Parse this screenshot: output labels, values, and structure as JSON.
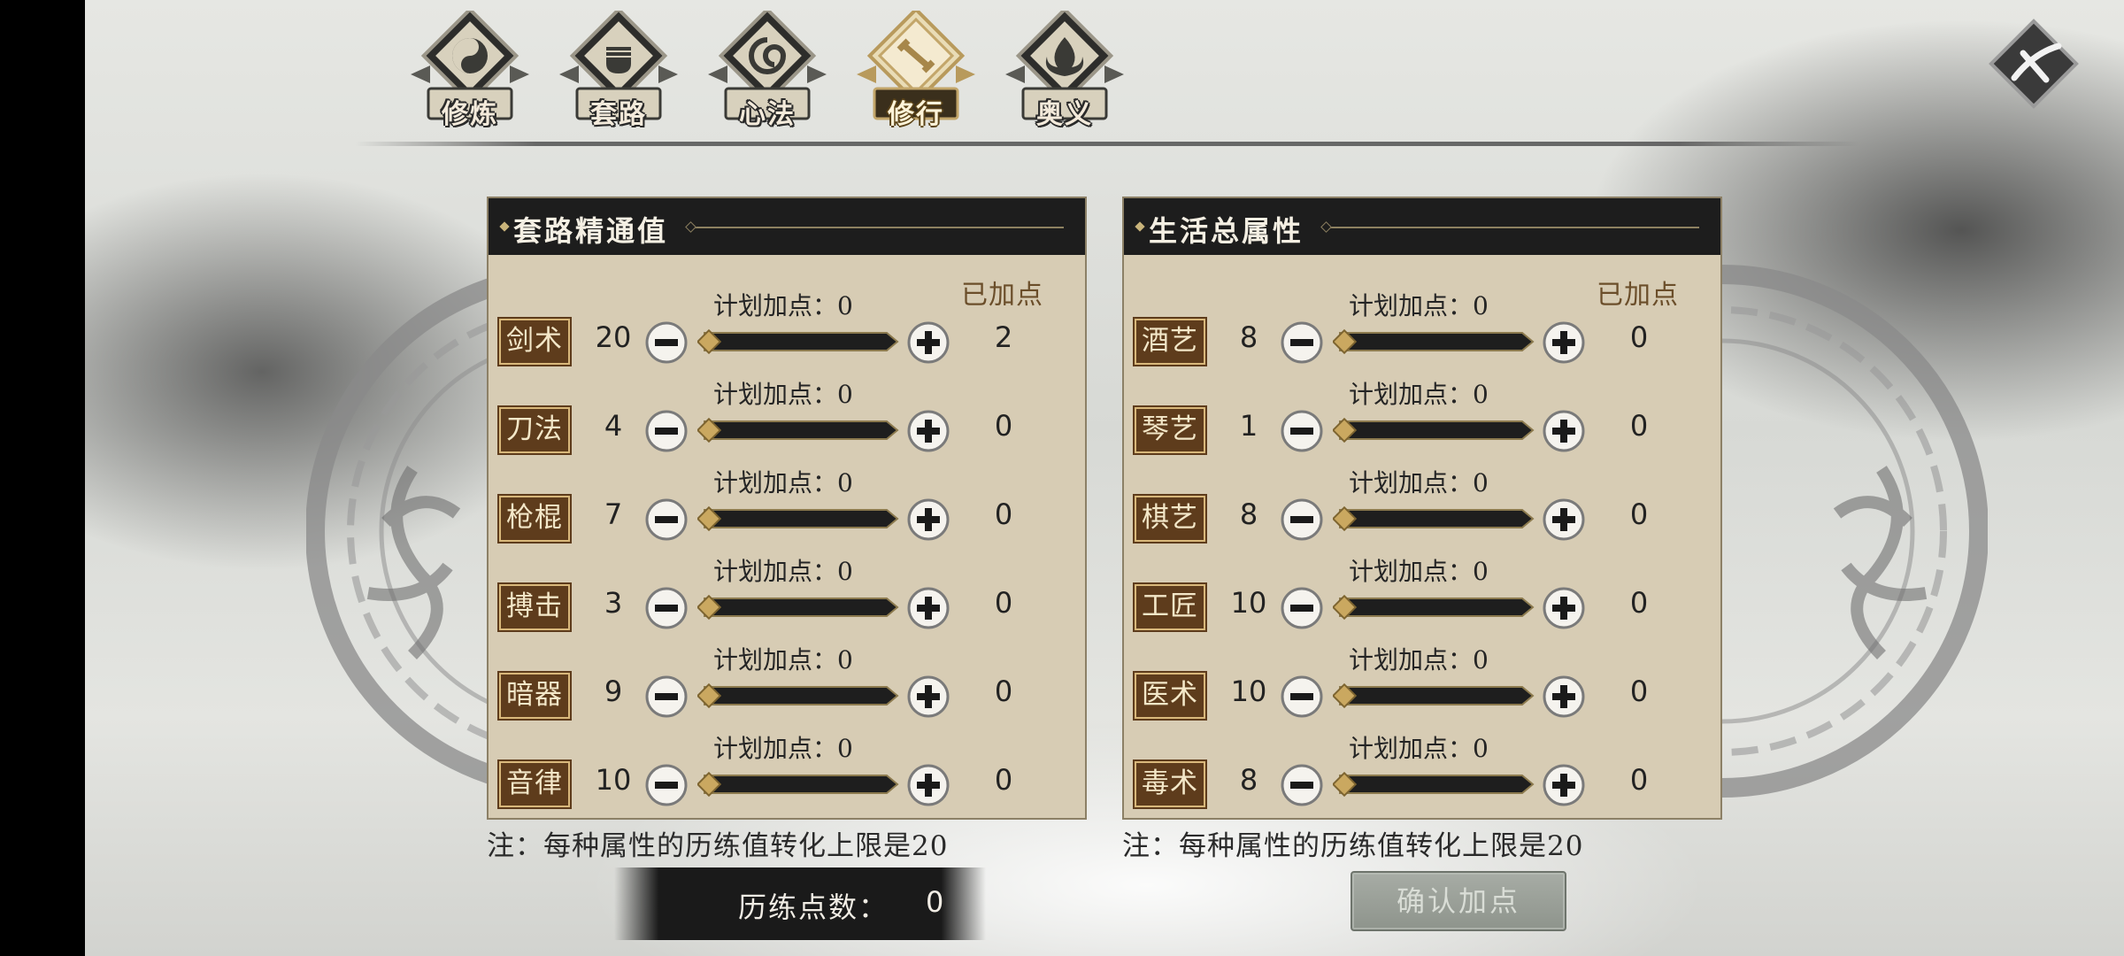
{
  "tabs": [
    {
      "label": "修炼",
      "icon": "taiji-emblem-icon",
      "active": false
    },
    {
      "label": "套路",
      "icon": "fist-emblem-icon",
      "active": false
    },
    {
      "label": "心法",
      "icon": "swirl-emblem-icon",
      "active": false
    },
    {
      "label": "修行",
      "icon": "scroll-emblem-icon",
      "active": true
    },
    {
      "label": "奥义",
      "icon": "flame-emblem-icon",
      "active": false
    }
  ],
  "close_icon": "close-icon",
  "left_panel": {
    "title": "套路精通值",
    "added_header": "已加点",
    "rows": [
      {
        "name": "剑术",
        "value": "20",
        "plan": "计划加点：0",
        "added": "2",
        "slider_level": 0
      },
      {
        "name": "刀法",
        "value": "4",
        "plan": "计划加点：0",
        "added": "0",
        "slider_level": 0
      },
      {
        "name": "枪棍",
        "value": "7",
        "plan": "计划加点：0",
        "added": "0",
        "slider_level": 0
      },
      {
        "name": "搏击",
        "value": "3",
        "plan": "计划加点：0",
        "added": "0",
        "slider_level": 0
      },
      {
        "name": "暗器",
        "value": "9",
        "plan": "计划加点：0",
        "added": "0",
        "slider_level": 0
      },
      {
        "name": "音律",
        "value": "10",
        "plan": "计划加点：0",
        "added": "0",
        "slider_level": 0
      }
    ],
    "note": "注：每种属性的历练值转化上限是20"
  },
  "right_panel": {
    "title": "生活总属性",
    "added_header": "已加点",
    "rows": [
      {
        "name": "酒艺",
        "value": "8",
        "plan": "计划加点：0",
        "added": "0",
        "slider_level": 0
      },
      {
        "name": "琴艺",
        "value": "1",
        "plan": "计划加点：0",
        "added": "0",
        "slider_level": 0
      },
      {
        "name": "棋艺",
        "value": "8",
        "plan": "计划加点：0",
        "added": "0",
        "slider_level": 0
      },
      {
        "name": "工匠",
        "value": "10",
        "plan": "计划加点：0",
        "added": "0",
        "slider_level": 0
      },
      {
        "name": "医术",
        "value": "10",
        "plan": "计划加点：0",
        "added": "0",
        "slider_level": 0
      },
      {
        "name": "毒术",
        "value": "8",
        "plan": "计划加点：0",
        "added": "0",
        "slider_level": 0
      }
    ],
    "note": "注：每种属性的历练值转化上限是20"
  },
  "points": {
    "label": "历练点数：",
    "value": "0"
  },
  "confirm_label": "确认加点",
  "colors": {
    "panel_bg": "#d7ccb4",
    "header_bg": "#1d1d1d",
    "label_brown": "#5e3c1c",
    "gold": "#d8b77a"
  }
}
